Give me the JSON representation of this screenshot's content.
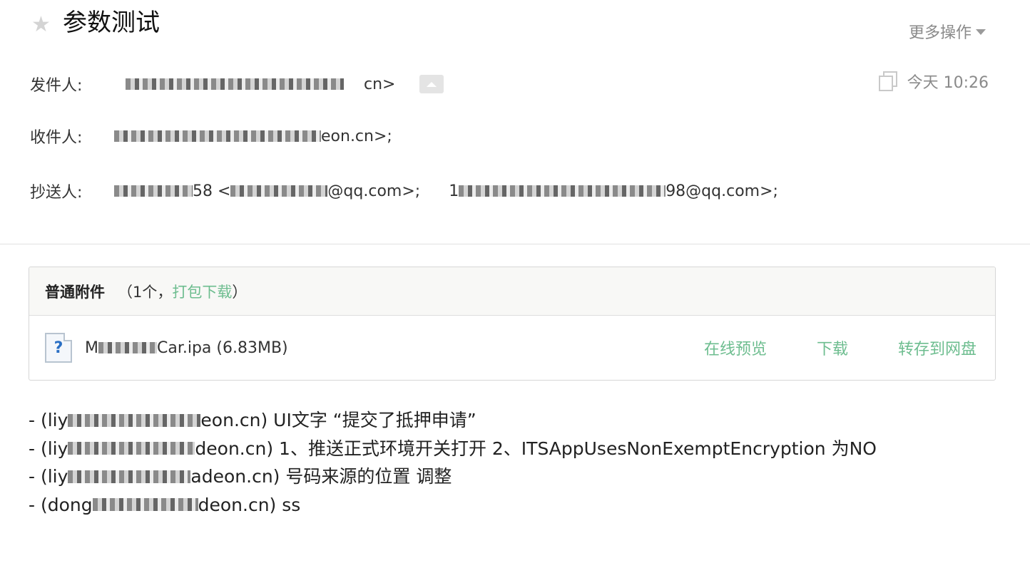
{
  "header": {
    "star_glyph": "★",
    "subject": "参数测试",
    "more_ops_label": "更多操作"
  },
  "from": {
    "label": "发件人:",
    "suffix": "cn>"
  },
  "time": "今天 10:26",
  "to": {
    "label": "收件人:",
    "suffix": "eon.cn>;"
  },
  "cc": {
    "label": "抄送人:",
    "addr1_fragment": "58 <",
    "addr1_suffix": "@qq.com>;",
    "addr2_prefix": "1",
    "addr2_suffix": "98@qq.com>;"
  },
  "attachments": {
    "title": "普通附件",
    "count_open": "（1个，",
    "download_all_label": "打包下载",
    "count_close": "）",
    "file": {
      "icon_glyph": "?",
      "name_prefix": "M",
      "name_suffix": "Car.ipa (6.83MB)"
    },
    "actions": {
      "preview": "在线预览",
      "download": "下载",
      "save_to_disk": "转存到网盘"
    }
  },
  "body": {
    "lines": [
      {
        "prefix": "- (liy",
        "suffix": "eon.cn) UI文字 “提交了抵押申请”"
      },
      {
        "prefix": "- (liy",
        "suffix": "deon.cn) 1、推送正式环境开关打开 2、ITSAppUsesNonExemptEncryption 为NO"
      },
      {
        "prefix": "- (liy",
        "suffix": "adeon.cn) 号码来源的位置 调整"
      },
      {
        "prefix": "- (dong",
        "suffix": "deon.cn) ss"
      }
    ]
  },
  "colors": {
    "link_green": "#6dbd8f",
    "muted_gray": "#8a8a8a"
  }
}
